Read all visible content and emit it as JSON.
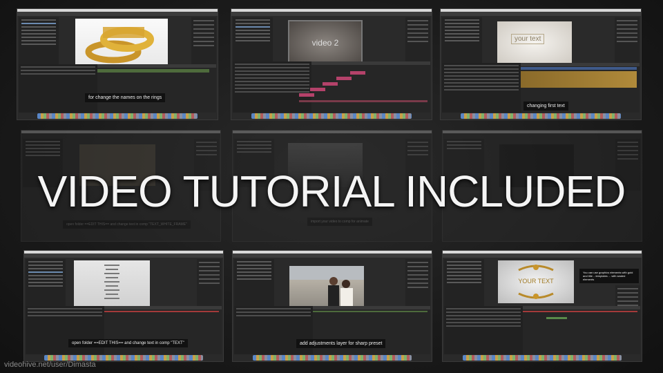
{
  "headline": "VIDEO TUTORIAL INCLUDED",
  "credit": "videohive.net/user/Dimasta",
  "colors": {
    "accent_gold": "#c9952a",
    "text": "#f4f4f4",
    "background": "#1a1a1a"
  },
  "screenshots": [
    {
      "name": "rings-3d-preview",
      "caption": "for change the names on the rings",
      "preview_text": ""
    },
    {
      "name": "video-2-preview",
      "caption": "",
      "preview_text": "video 2"
    },
    {
      "name": "your-text-preview",
      "caption": "changing first text",
      "preview_text": "your text"
    },
    {
      "name": "dim-gold-frame-preview",
      "caption": "open folder ==EDIT THIS== and change text in comp \"TEXT_WHITE_FRAME\"",
      "preview_text": ""
    },
    {
      "name": "dim-dark-preview",
      "caption": "import your video to comp for animate",
      "preview_text": ""
    },
    {
      "name": "dim-empty-preview",
      "caption": "",
      "preview_text": ""
    },
    {
      "name": "layer-list-preview",
      "caption": "open folder ==EDIT THIS== and change text in comp \"TEXT\"",
      "preview_text": ""
    },
    {
      "name": "wedding-photo-preview",
      "caption": "add adjustments layer for sharp preset",
      "preview_text": ""
    },
    {
      "name": "ornament-frame-preview",
      "caption": "",
      "preview_text": "YOUR TEXT",
      "note": "You can use graphics elements with gold and title ...templates ... with sealed elements"
    }
  ]
}
